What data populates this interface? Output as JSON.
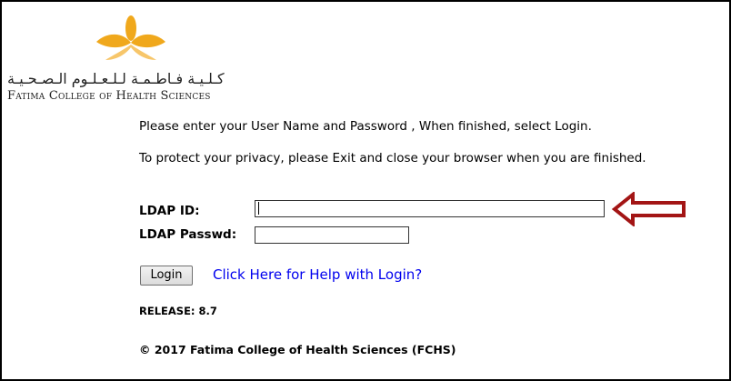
{
  "logo": {
    "arabic_text": "كـلـيـة فـاطـمـة لـلـعـلـوم الـصـحـيـة",
    "english_text": "Fatima College of Health Sciences",
    "icon": "petal-flower-logo",
    "colors": {
      "orange": "#f0a81c",
      "light_orange": "#f7c66a"
    }
  },
  "instructions": {
    "line1": "Please enter your User Name and Password , When finished, select Login.",
    "line2": "To protect your privacy, please Exit and close your browser when you are finished."
  },
  "form": {
    "ldap_id_label": "LDAP ID:",
    "ldap_id_value": "",
    "ldap_passwd_label": "LDAP Passwd:",
    "ldap_passwd_value": ""
  },
  "annotation": {
    "icon": "left-arrow-icon",
    "color": "#a31515"
  },
  "login_button_label": "Login",
  "help_link": {
    "text": "Click Here for Help with Login?",
    "color": "#0000ee"
  },
  "release": "RELEASE: 8.7",
  "copyright": "© 2017 Fatima College of Health Sciences (FCHS)"
}
